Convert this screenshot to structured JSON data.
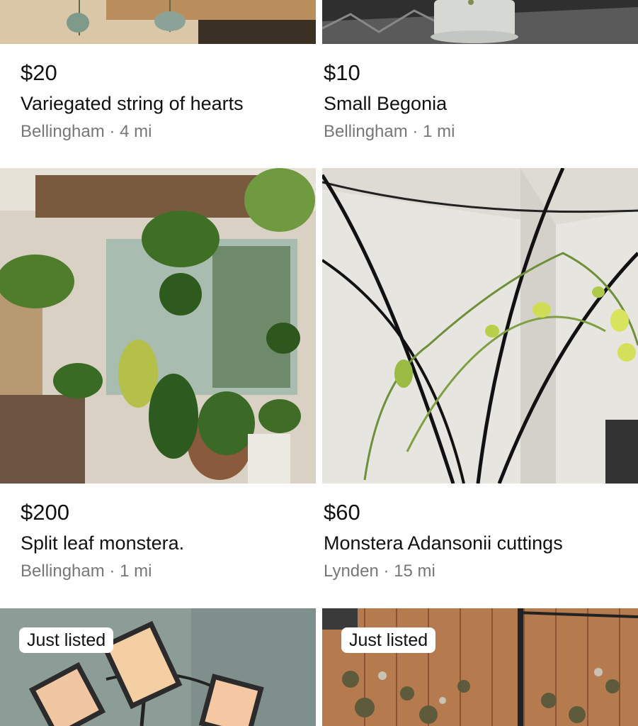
{
  "listings": [
    {
      "price": "$20",
      "title": "Variegated string of hearts",
      "location": "Bellingham",
      "distance": "4 mi",
      "badge": "",
      "image_icon": "string-of-hearts-photo"
    },
    {
      "price": "$10",
      "title": "Small Begonia",
      "location": "Bellingham",
      "distance": "1 mi",
      "badge": "",
      "image_icon": "begonia-pot-photo"
    },
    {
      "price": "$200",
      "title": "Split leaf monstera.",
      "location": "Bellingham",
      "distance": "1 mi",
      "badge": "",
      "image_icon": "monstera-photo"
    },
    {
      "price": "$60",
      "title": "Monstera Adansonii cuttings",
      "location": "Lynden",
      "distance": "15 mi",
      "badge": "",
      "image_icon": "adansonii-trellis-photo"
    },
    {
      "price": "",
      "title": "",
      "location": "",
      "distance": "",
      "badge": "Just listed",
      "image_icon": "grow-lights-photo"
    },
    {
      "price": "",
      "title": "",
      "location": "",
      "distance": "",
      "badge": "Just listed",
      "image_icon": "plants-on-wood-wall-photo"
    }
  ],
  "separator": " · ",
  "colors": {
    "price": "#111111",
    "location": "#777777",
    "background": "#ffffff"
  }
}
